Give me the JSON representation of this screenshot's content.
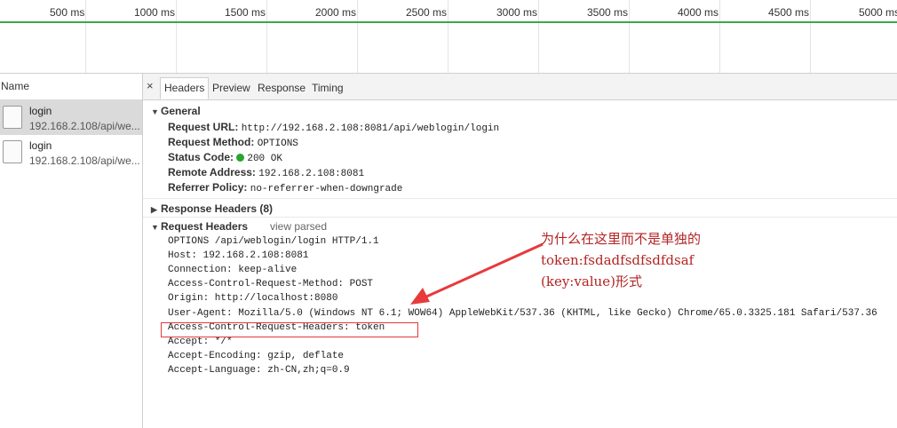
{
  "timeline": {
    "ticks": [
      "500 ms",
      "1000 ms",
      "1500 ms",
      "2000 ms",
      "2500 ms",
      "3000 ms",
      "3500 ms",
      "4000 ms",
      "4500 ms",
      "5000 ms"
    ]
  },
  "list": {
    "header": "Name",
    "items": [
      {
        "name": "login",
        "url": "192.168.2.108/api/we..."
      },
      {
        "name": "login",
        "url": "192.168.2.108/api/we..."
      }
    ]
  },
  "tabs": {
    "close": "×",
    "items": [
      "Headers",
      "Preview",
      "Response",
      "Timing"
    ]
  },
  "general": {
    "title": "General",
    "rows": [
      {
        "key": "Request URL:",
        "value": "http://192.168.2.108:8081/api/weblogin/login"
      },
      {
        "key": "Request Method:",
        "value": "OPTIONS"
      },
      {
        "key": "Status Code:",
        "value": "200 OK"
      },
      {
        "key": "Remote Address:",
        "value": "192.168.2.108:8081"
      },
      {
        "key": "Referrer Policy:",
        "value": "no-referrer-when-downgrade"
      }
    ]
  },
  "response_headers": {
    "title": "Response Headers (8)"
  },
  "request_headers": {
    "title": "Request Headers",
    "view_parsed": "view parsed",
    "lines": [
      "OPTIONS /api/weblogin/login HTTP/1.1",
      "Host: 192.168.2.108:8081",
      "Connection: keep-alive",
      "Access-Control-Request-Method: POST",
      "Origin: http://localhost:8080",
      "User-Agent: Mozilla/5.0 (Windows NT 6.1; WOW64) AppleWebKit/537.36 (KHTML, like Gecko) Chrome/65.0.3325.181 Safari/537.36",
      "Access-Control-Request-Headers: token",
      "Accept: */*",
      "Accept-Encoding: gzip, deflate",
      "Accept-Language: zh-CN,zh;q=0.9"
    ]
  },
  "annotation": {
    "lines": [
      "为什么在这里而不是单独的",
      "token:fsdadfsdfsdfdsaf",
      "(key:value)形式"
    ],
    "color": "#b32424"
  },
  "colors": {
    "status_ok": "#27a52f",
    "timeline_bar": "#3ba64b",
    "highlight": "#e2383a"
  }
}
